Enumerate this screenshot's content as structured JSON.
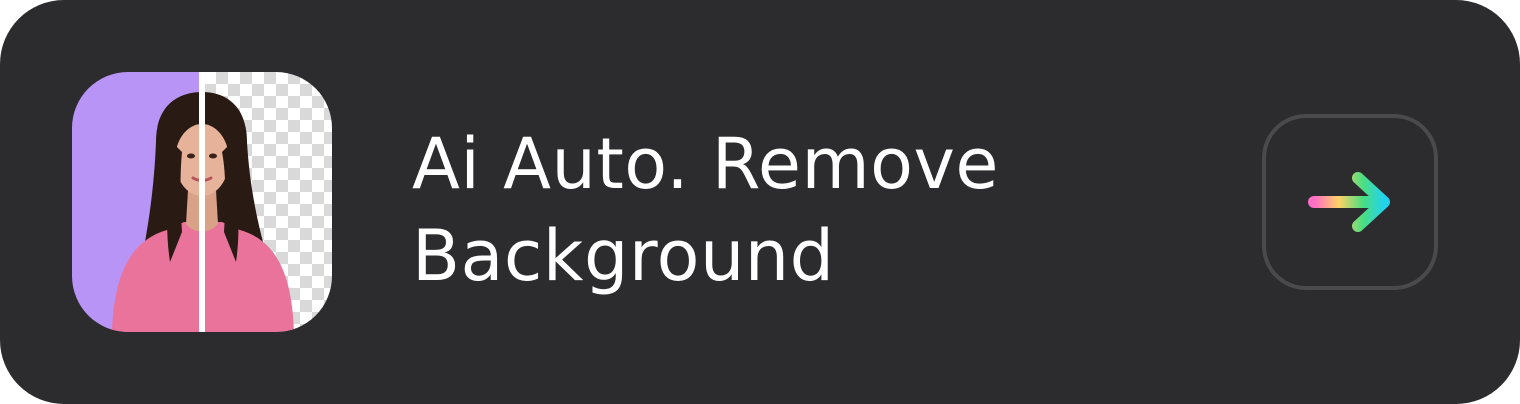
{
  "card": {
    "title_line_1": "Ai Auto. Remove",
    "title_line_2": "Background",
    "background_color": "#2c2b2d"
  },
  "thumbnail": {
    "icon": "background-removal-preview",
    "left_color": "#b794f6",
    "divider_color": "#ffffff"
  },
  "action": {
    "icon": "arrow-right-icon",
    "gradient": [
      "#ff6ec7",
      "#ffd166",
      "#4ade80",
      "#22d3ee"
    ]
  }
}
